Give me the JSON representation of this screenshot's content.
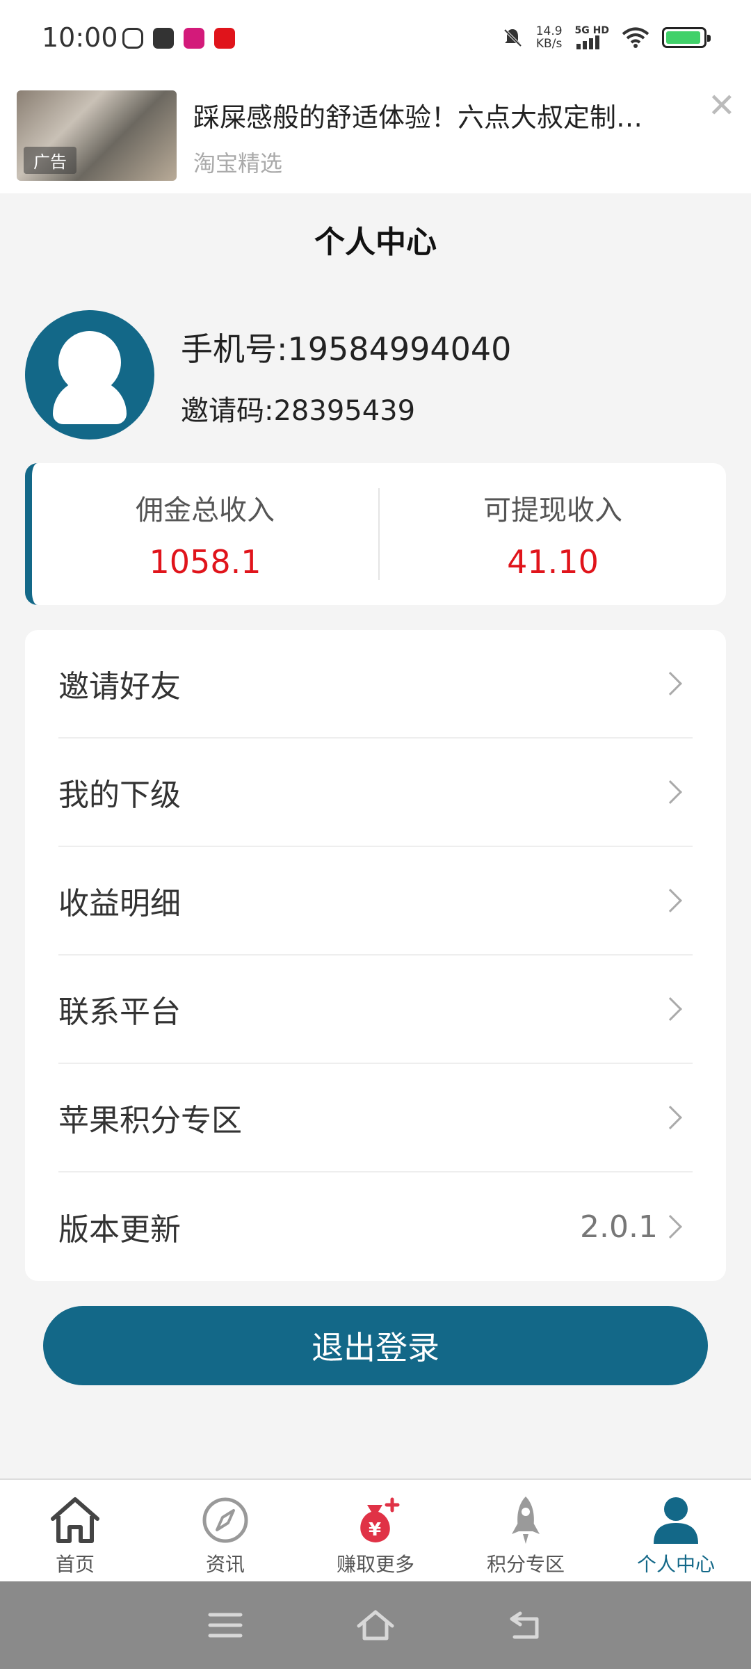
{
  "status_bar": {
    "time": "10:00",
    "speed_value": "14.9",
    "speed_unit": "KB/s",
    "network": "5G HD",
    "battery_level": 0.95
  },
  "ad": {
    "tag": "广告",
    "title": "踩屎感般的舒适体验！六点大叔定制…",
    "source": "淘宝精选",
    "close": "✕"
  },
  "header": {
    "title": "个人中心"
  },
  "profile": {
    "phone": "手机号:19584994040",
    "invite_code": "邀请码:28395439"
  },
  "income": {
    "total_label": "佣金总收入",
    "total_value": "1058.1",
    "withdrawable_label": "可提现收入",
    "withdrawable_value": "41.10"
  },
  "menu": [
    {
      "label": "邀请好友",
      "value": ""
    },
    {
      "label": "我的下级",
      "value": ""
    },
    {
      "label": "收益明细",
      "value": ""
    },
    {
      "label": "联系平台",
      "value": ""
    },
    {
      "label": "苹果积分专区",
      "value": ""
    },
    {
      "label": "版本更新",
      "value": "2.0.1"
    }
  ],
  "logout_label": "退出登录",
  "tabs": [
    {
      "label": "首页",
      "icon": "home-icon"
    },
    {
      "label": "资讯",
      "icon": "compass-icon"
    },
    {
      "label": "赚取更多",
      "icon": "money-bag-icon"
    },
    {
      "label": "积分专区",
      "icon": "rocket-icon"
    },
    {
      "label": "个人中心",
      "icon": "person-icon",
      "active": true
    }
  ],
  "colors": {
    "accent": "#136888",
    "money": "#e0141b"
  }
}
